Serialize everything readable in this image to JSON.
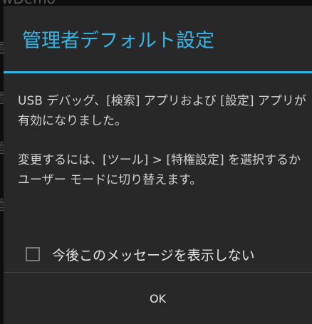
{
  "background": {
    "app_title_fragment": "wDemo",
    "side_glyph": "置"
  },
  "dialog": {
    "title": "管理者デフォルト設定",
    "message_1": "USB デバッグ、[検索] アプリおよび [設定] アプリが有効になりました。",
    "message_2": "変更するには、[ツール] > [特権設定] を選択するかユーザー モードに切り替えます。",
    "checkbox": {
      "label": "今後このメッセージを表示しない",
      "checked": false
    },
    "ok_label": "OK"
  },
  "colors": {
    "accent": "#33b5e5",
    "dialog_background": "#282828",
    "text": "#d2d2d2"
  }
}
